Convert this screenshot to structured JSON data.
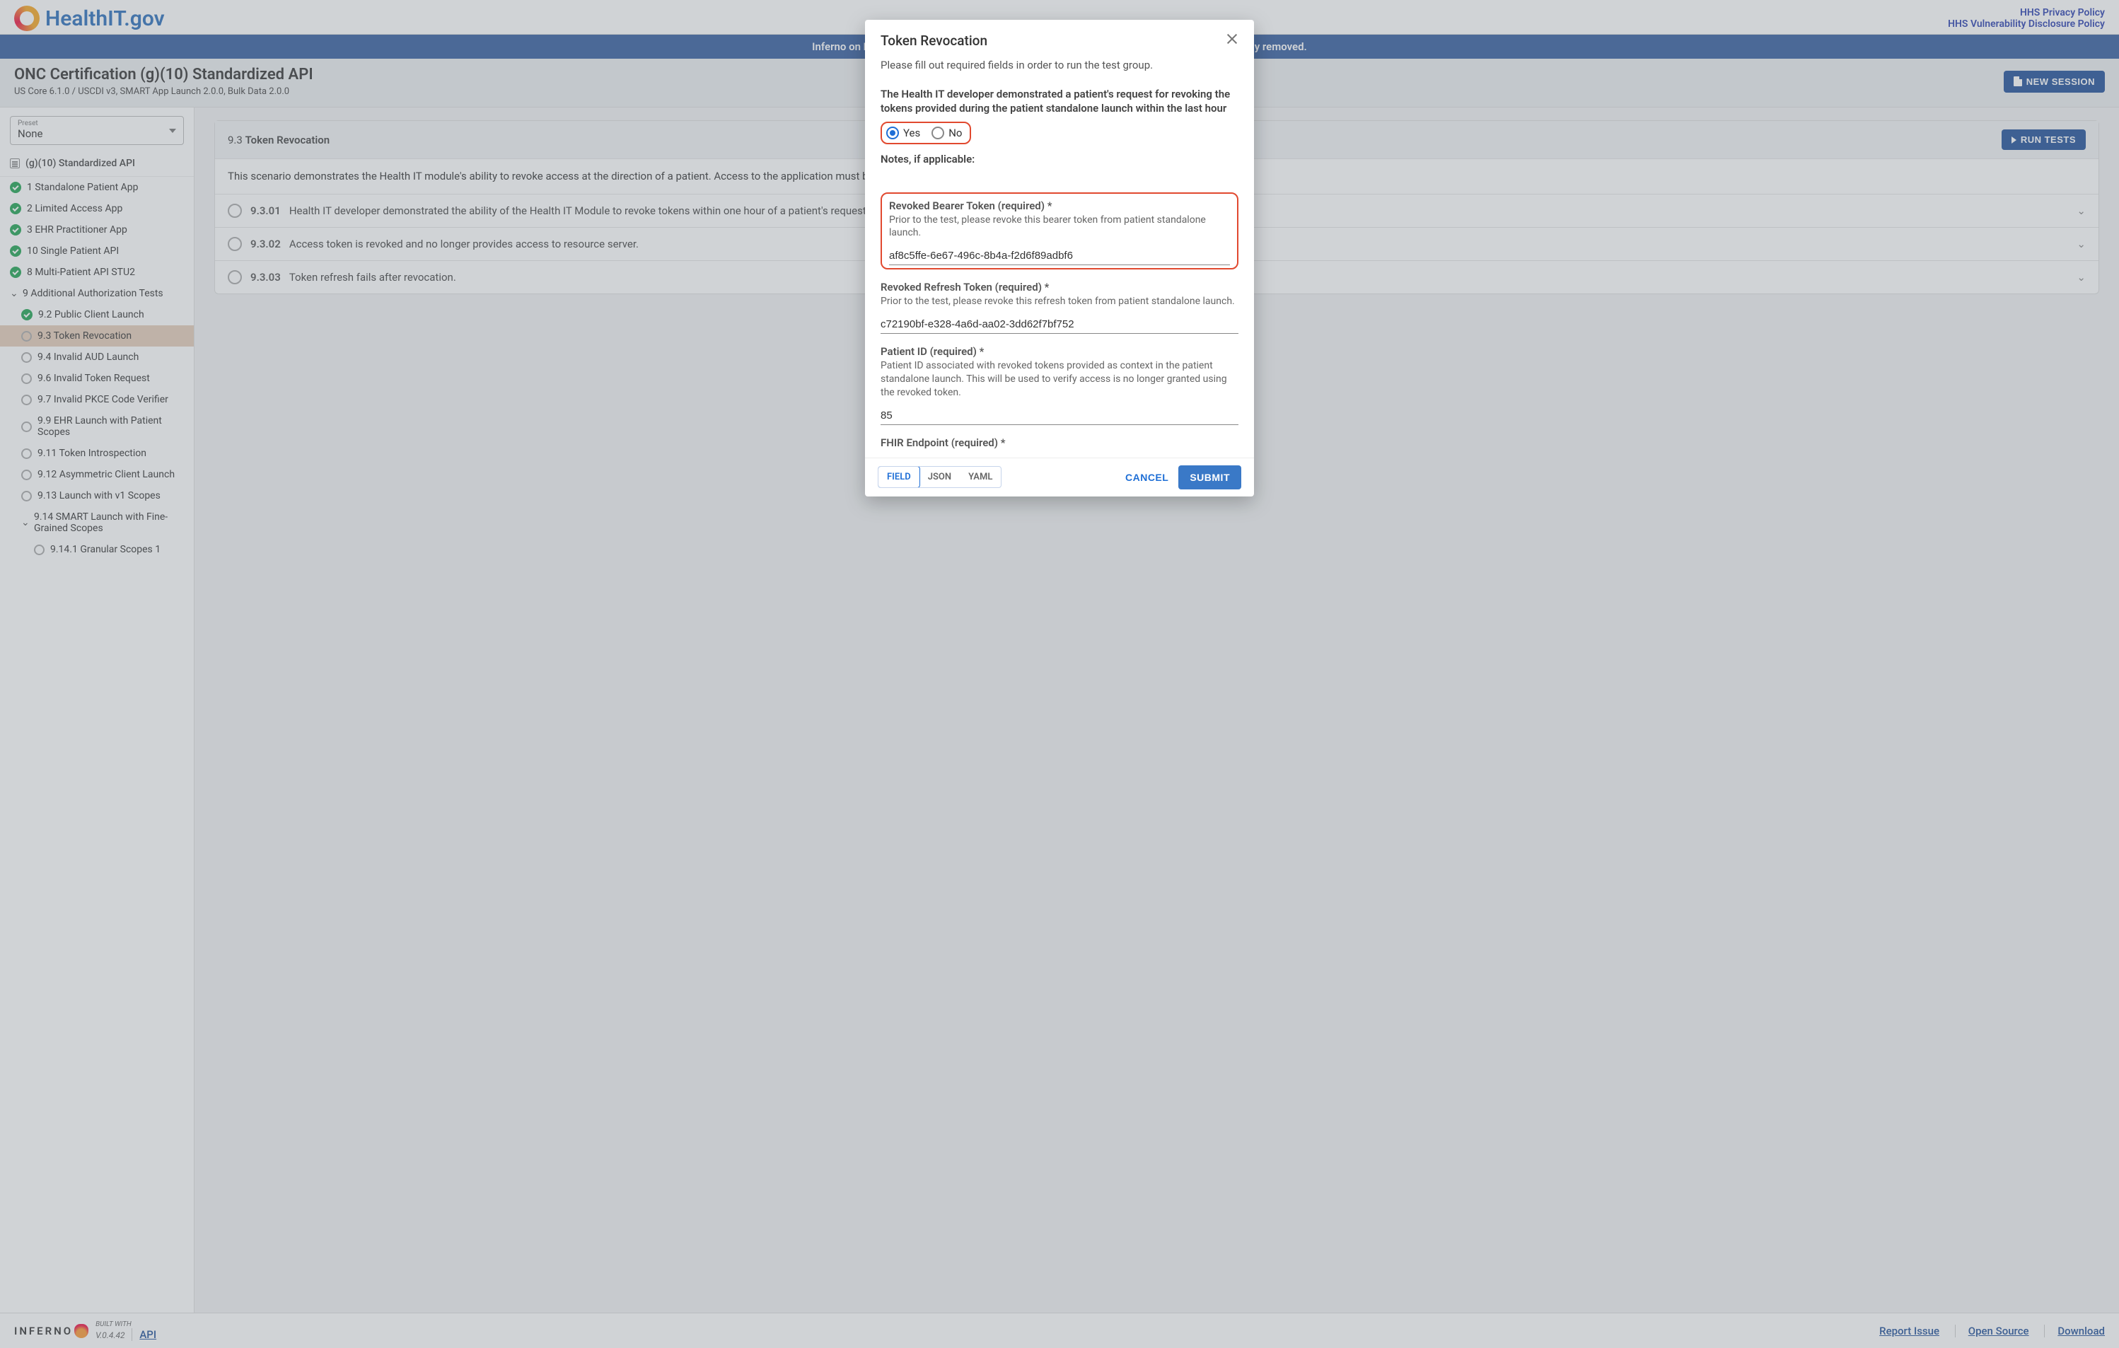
{
  "header": {
    "logo_text": "HealthIT.gov",
    "links": {
      "privacy": "HHS Privacy Policy",
      "vuln": "HHS Vulnerability Disclosure Policy"
    }
  },
  "banner": "Inferno on HealthIT.gov is for demonstration purposes only. Do not store PHI. Data periodically removed.",
  "subheader": {
    "title": "ONC Certification (g)(10) Standardized API",
    "subtitle": "US Core 6.1.0 / USCDI v3, SMART App Launch 2.0.0, Bulk Data 2.0.0",
    "new_session": "NEW SESSION"
  },
  "sidebar": {
    "preset_label": "Preset",
    "preset_value": "None",
    "heading": "(g)(10) Standardized API",
    "items": [
      {
        "label": "1 Standalone Patient App",
        "status": "check"
      },
      {
        "label": "2 Limited Access App",
        "status": "check"
      },
      {
        "label": "3 EHR Practitioner App",
        "status": "check"
      },
      {
        "label": "10 Single Patient API",
        "status": "check"
      },
      {
        "label": "8 Multi-Patient API STU2",
        "status": "check"
      },
      {
        "label": "9 Additional Authorization Tests",
        "status": "chev-open"
      },
      {
        "label": "9.2 Public Client Launch",
        "status": "check",
        "indent": 1
      },
      {
        "label": "9.3 Token Revocation",
        "status": "open",
        "indent": 1,
        "active": true
      },
      {
        "label": "9.4 Invalid AUD Launch",
        "status": "open",
        "indent": 1
      },
      {
        "label": "9.6 Invalid Token Request",
        "status": "open",
        "indent": 1
      },
      {
        "label": "9.7 Invalid PKCE Code Verifier",
        "status": "open",
        "indent": 1
      },
      {
        "label": "9.9 EHR Launch with Patient Scopes",
        "status": "open",
        "indent": 1
      },
      {
        "label": "9.11 Token Introspection",
        "status": "open",
        "indent": 1
      },
      {
        "label": "9.12 Asymmetric Client Launch",
        "status": "open",
        "indent": 1
      },
      {
        "label": "9.13 Launch with v1 Scopes",
        "status": "open",
        "indent": 1
      },
      {
        "label": "9.14 SMART Launch with Fine-Grained Scopes",
        "status": "chev-open",
        "indent": 1
      },
      {
        "label": "9.14.1 Granular Scopes 1",
        "status": "open",
        "indent": 2
      }
    ]
  },
  "main": {
    "section_num": "9.3",
    "section_title": "Token Revocation",
    "run_tests": "RUN TESTS",
    "description": "This scenario demonstrates the Health IT module's ability to revoke access at the direction of a patient. Access to the application must be revoked within one hour.",
    "rows": [
      {
        "num": "9.3.01",
        "title": "Health IT developer demonstrated the ability of the Health IT Module to revoke tokens within one hour of a patient's request."
      },
      {
        "num": "9.3.02",
        "title": "Access token is revoked and no longer provides access to resource server."
      },
      {
        "num": "9.3.03",
        "title": "Token refresh fails after revocation."
      }
    ]
  },
  "footer": {
    "brand": "INFERNO",
    "built": "BUILT WITH",
    "version": "V.0.4.42",
    "api": "API",
    "links": {
      "report": "Report Issue",
      "oss": "Open Source",
      "download": "Download"
    }
  },
  "modal": {
    "title": "Token Revocation",
    "subtitle": "Please fill out required fields in order to run the test group.",
    "question": "The Health IT developer demonstrated a patient's request for revoking the tokens provided during the patient standalone launch within the last hour",
    "yes": "Yes",
    "no": "No",
    "notes_label": "Notes, if applicable:",
    "fields": {
      "bearer": {
        "label": "Revoked Bearer Token (required) *",
        "help": "Prior to the test, please revoke this bearer token from patient standalone launch.",
        "value": "af8c5ffe-6e67-496c-8b4a-f2d6f89adbf6"
      },
      "refresh": {
        "label": "Revoked Refresh Token (required) *",
        "help": "Prior to the test, please revoke this refresh token from patient standalone launch.",
        "value": "c72190bf-e328-4a6d-aa02-3dd62f7bf752"
      },
      "patient": {
        "label": "Patient ID (required) *",
        "help": "Patient ID associated with revoked tokens provided as context in the patient standalone launch. This will be used to verify access is no longer granted using the revoked token.",
        "value": "85"
      },
      "fhir": {
        "label": "FHIR Endpoint (required) *"
      }
    },
    "tabs": {
      "field": "FIELD",
      "json": "JSON",
      "yaml": "YAML"
    },
    "cancel": "CANCEL",
    "submit": "SUBMIT"
  }
}
